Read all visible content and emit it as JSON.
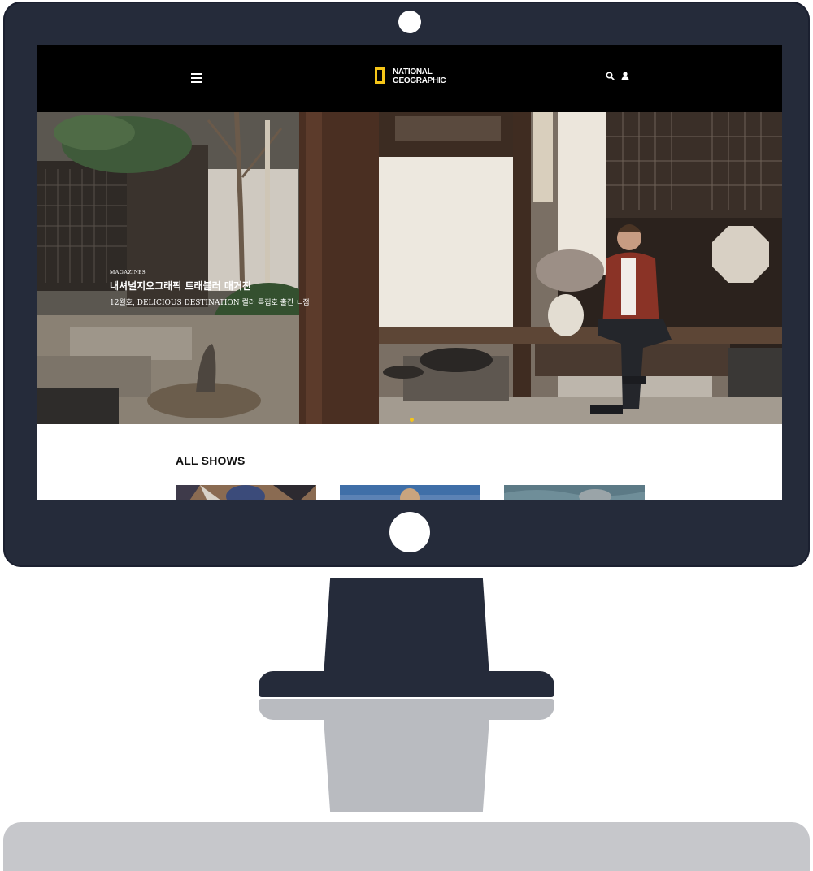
{
  "header": {
    "logo_line1": "NATIONAL",
    "logo_line2": "GEOGRAPHIC",
    "brand_color": "#f5c518",
    "menu_icon": "hamburger-menu-icon",
    "search_icon": "search-icon",
    "user_icon": "user-icon"
  },
  "hero": {
    "kicker": "MAGAZINES",
    "title": "내셔널지오그래픽 트래블러 매거진",
    "subtitle": "12월호, DELICIOUS DESTINATION 컬러 특집호 출간 ㄴ점",
    "slide_count": 1
  },
  "shows": {
    "title": "ALL SHOWS",
    "cards": [
      "show-card-1",
      "show-card-2",
      "show-card-3"
    ]
  }
}
